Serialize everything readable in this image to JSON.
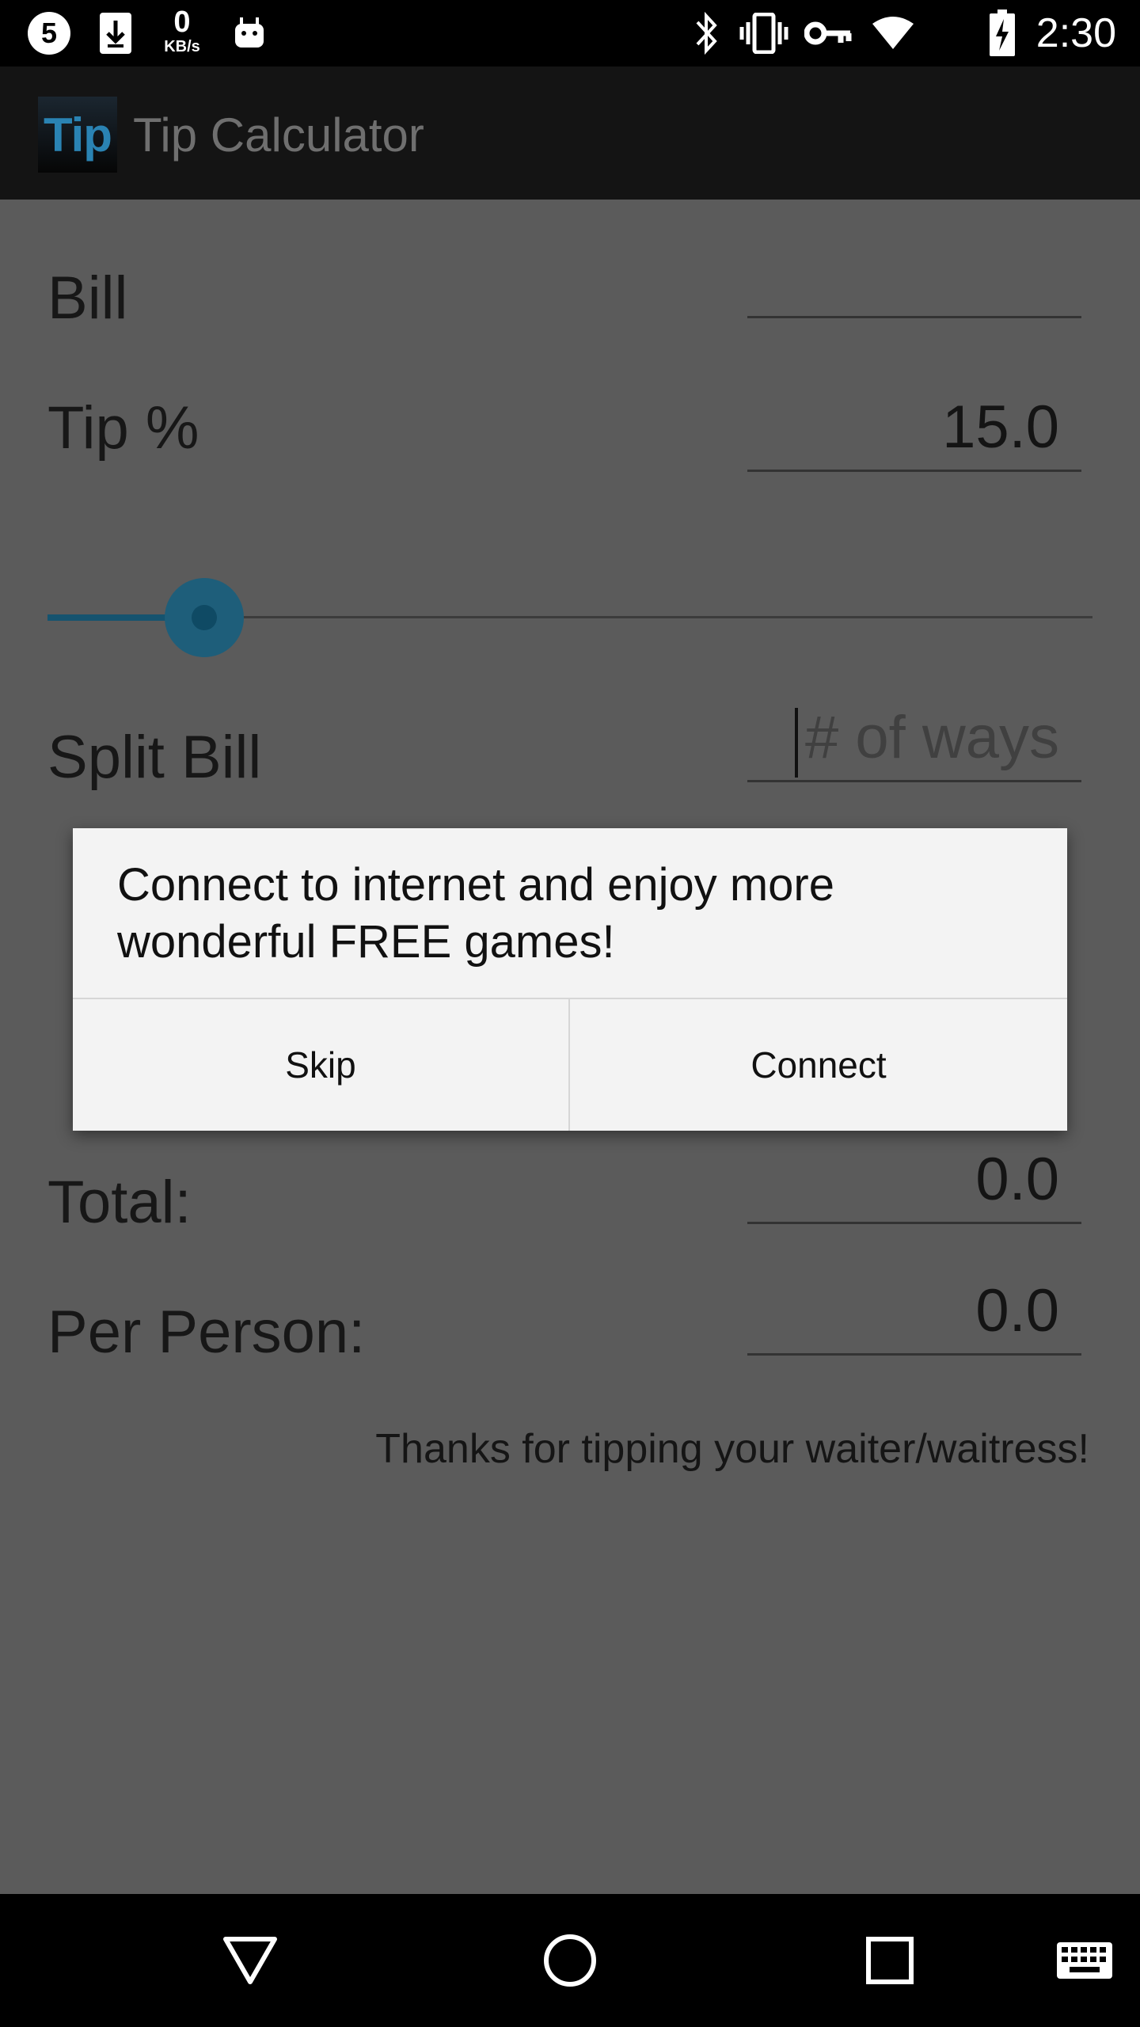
{
  "status_bar": {
    "time": "2:30",
    "network_speed_value": "0",
    "network_speed_unit": "KB/s",
    "icons": [
      "notification-5-icon",
      "download-icon",
      "android-icon",
      "bluetooth-icon",
      "vibrate-icon",
      "vpn-key-icon",
      "wifi-icon",
      "battery-charging-icon"
    ]
  },
  "action_bar": {
    "logo_text": "Tip",
    "title": "Tip Calculator"
  },
  "form": {
    "bill_label": "Bill",
    "bill_value": "",
    "tip_label": "Tip %",
    "tip_value": "15.0",
    "tip_slider_fraction": 0.15,
    "split_label": "Split Bill",
    "split_placeholder": "# of ways",
    "total_label": "Total:",
    "total_value": "0.0",
    "per_person_label": "Per Person:",
    "per_person_value": "0.0",
    "thanks_text": "Thanks for tipping your waiter/waitress!"
  },
  "dialog": {
    "message": "Connect to internet and enjoy more wonderful FREE games!",
    "skip_label": "Skip",
    "connect_label": "Connect"
  },
  "nav_bar": {
    "icons": [
      "back-icon",
      "home-icon",
      "recents-icon",
      "keyboard-icon"
    ]
  },
  "colors": {
    "scrim": "#5b5b5b",
    "accent": "#15536f",
    "dialog_bg": "#f3f3f3"
  }
}
